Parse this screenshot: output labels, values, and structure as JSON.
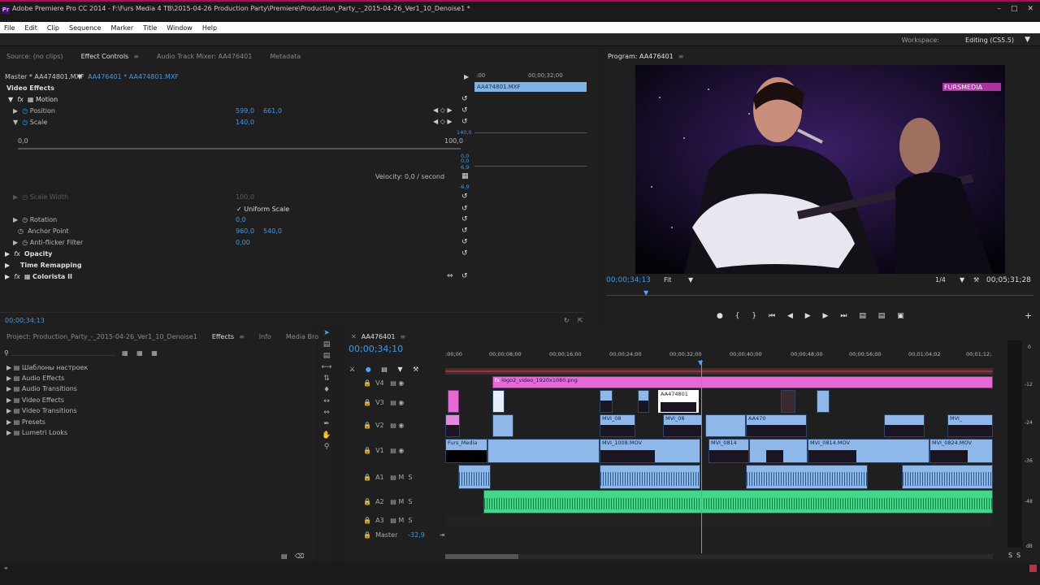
{
  "window": {
    "title": "Adobe Premiere Pro CC 2014 - F:\\Furs Media 4 TB\\2015-04-26 Production Party\\Premiere\\Production_Party_-_2015-04-26_Ver1_10_Denoise1 *"
  },
  "menu": [
    "File",
    "Edit",
    "Clip",
    "Sequence",
    "Marker",
    "Title",
    "Window",
    "Help"
  ],
  "workspace": {
    "label": "Workspace:",
    "value": "Editing (CS5.5)"
  },
  "source_panel": {
    "tabs": [
      "Source: (no clips)",
      "Effect Controls",
      "Audio Track Mixer: AA476401",
      "Metadata"
    ],
    "active_tab": "Effect Controls"
  },
  "effect_controls": {
    "master": "Master * AA474801.MXF",
    "clip": "AA476401 * AA474801.MXF",
    "ruler_start": ":00",
    "ruler_mid": "00;00;32;00",
    "clip_label": "AA474801.MXF",
    "section": "Video Effects",
    "motion": "Motion",
    "position": {
      "label": "Position",
      "x": "599,0",
      "y": "661,0"
    },
    "scale": {
      "label": "Scale",
      "value": "140,0"
    },
    "slider_min": "0,0",
    "slider_max": "100,0",
    "graph_vals": [
      "140,0",
      "0,0",
      "0,0",
      "6,9",
      "-6,9"
    ],
    "velocity": "Velocity: 0,0 / second",
    "scale_width": {
      "label": "Scale Width",
      "value": "100,0"
    },
    "uniform_scale": "Uniform Scale",
    "rotation": {
      "label": "Rotation",
      "value": "0,0"
    },
    "anchor": {
      "label": "Anchor Point",
      "x": "960,0",
      "y": "540,0"
    },
    "antiflicker": {
      "label": "Anti-flicker Filter",
      "value": "0,00"
    },
    "opacity": "Opacity",
    "time_remap": "Time Remapping",
    "colorista": "Colorista II",
    "timecode": "00;00;34;13"
  },
  "program": {
    "title": "Program: AA476401",
    "timecode": "00;00;34;13",
    "fit": "Fit",
    "quality": "1/4",
    "duration": "00;05;31;28",
    "watermark": "FURSMEDIA"
  },
  "project_panel": {
    "tabs": [
      "Project: Production_Party_-_2015-04-26_Ver1_10_Denoise1",
      "Effects",
      "Info",
      "Media Browser"
    ],
    "active_tab": "Effects",
    "items": [
      "Шаблоны настроек",
      "Audio Effects",
      "Audio Transitions",
      "Video Effects",
      "Video Transitions",
      "Presets",
      "Lumetri Looks"
    ]
  },
  "timeline": {
    "tab": "AA476401",
    "timecode": "00;00;34;10",
    "ruler": [
      ":00;00",
      "00;00;08;00",
      "00;00;16;00",
      "00;00;24;00",
      "00;00;32;00",
      "00;00;40;00",
      "00;00;48;00",
      "00;00;56;00",
      "00;01;04;02",
      "00;01;12;"
    ],
    "tracks": [
      "V4",
      "V3",
      "V2",
      "V1",
      "A1",
      "A2",
      "A3"
    ],
    "master_label": "Master",
    "master_value": "-32,9",
    "clips": {
      "png": "logo2_video_1920x1080.png",
      "aa": "AA474801",
      "v2a": "MVI_08",
      "v2b": "MVI_08",
      "v2c": "AA470",
      "v2d": "MVI_",
      "v1a": "Furs_Media",
      "v1b": "MVI_1008.MOV",
      "v1c": "MVI_0814",
      "v1d": "MVI_0814.MOV",
      "v1e": "MVI_0824.MOV"
    }
  },
  "meter": {
    "labels": [
      "0",
      "-12",
      "-24",
      "-36",
      "-48",
      "dB"
    ],
    "solo": "S",
    "solo2": "S"
  }
}
